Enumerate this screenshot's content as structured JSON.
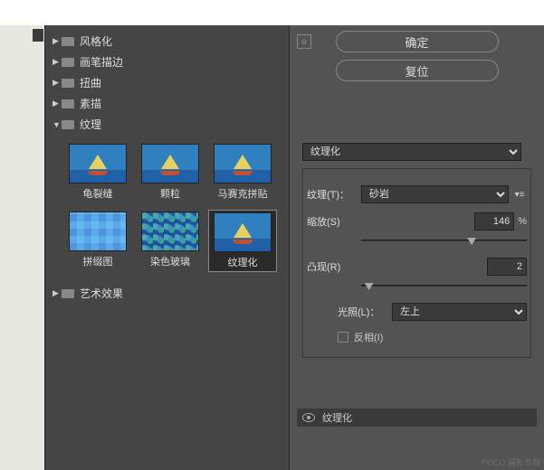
{
  "categories": [
    {
      "label": "风格化",
      "open": false
    },
    {
      "label": "画笔描边",
      "open": false
    },
    {
      "label": "扭曲",
      "open": false
    },
    {
      "label": "素描",
      "open": false
    },
    {
      "label": "纹理",
      "open": true
    },
    {
      "label": "艺术效果",
      "open": false
    }
  ],
  "thumbnails": [
    {
      "label": "龟裂缝"
    },
    {
      "label": "颗粒"
    },
    {
      "label": "马赛克拼贴"
    },
    {
      "label": "拼缀图"
    },
    {
      "label": "染色玻璃"
    },
    {
      "label": "纹理化",
      "selected": true
    }
  ],
  "buttons": {
    "ok": "确定",
    "reset": "复位"
  },
  "filter_select": "纹理化",
  "params": {
    "texture_label": "纹理(T)：",
    "texture_value": "砂岩",
    "scale_label": "缩放(S)",
    "scale_value": "146",
    "scale_pct": "%",
    "relief_label": "凸现(R)",
    "relief_value": "2",
    "light_label": "光照(L)：",
    "light_value": "左上",
    "invert_label": "反相(I)"
  },
  "layer_name": "纹理化",
  "watermark": "POCO 摄影专题"
}
